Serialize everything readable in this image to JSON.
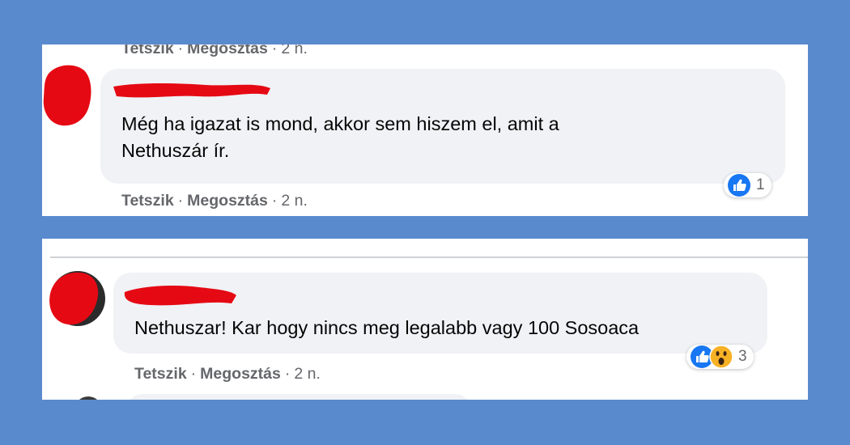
{
  "comment_top_partial": {
    "like_label": "Tetszik",
    "share_label": "Megosztás",
    "separator": "·",
    "time": "2 n."
  },
  "comment1": {
    "text_line1": "Még ha igazat is mond, akkor sem hiszem el, amit a",
    "text_line2": "Nethuszár ír.",
    "reaction_count": "1",
    "like_label": "Tetszik",
    "share_label": "Megosztás",
    "separator": "·",
    "time": "2 n."
  },
  "comment2": {
    "text": "Nethuszar! Kar hogy nincs meg legalabb vagy 100 Sosoaca",
    "reaction_count": "3",
    "like_label": "Tetszik",
    "share_label": "Megosztás",
    "separator": "·",
    "time": "2 n."
  },
  "colors": {
    "background": "#5a8ace",
    "bubble": "#f0f2f5",
    "redaction": "#e50914",
    "like_blue": "#1877f2",
    "wow_yellow": "#f7b125"
  },
  "icons": {
    "like_reaction": "thumbs-up-icon",
    "wow_reaction": "wow-face-icon"
  }
}
